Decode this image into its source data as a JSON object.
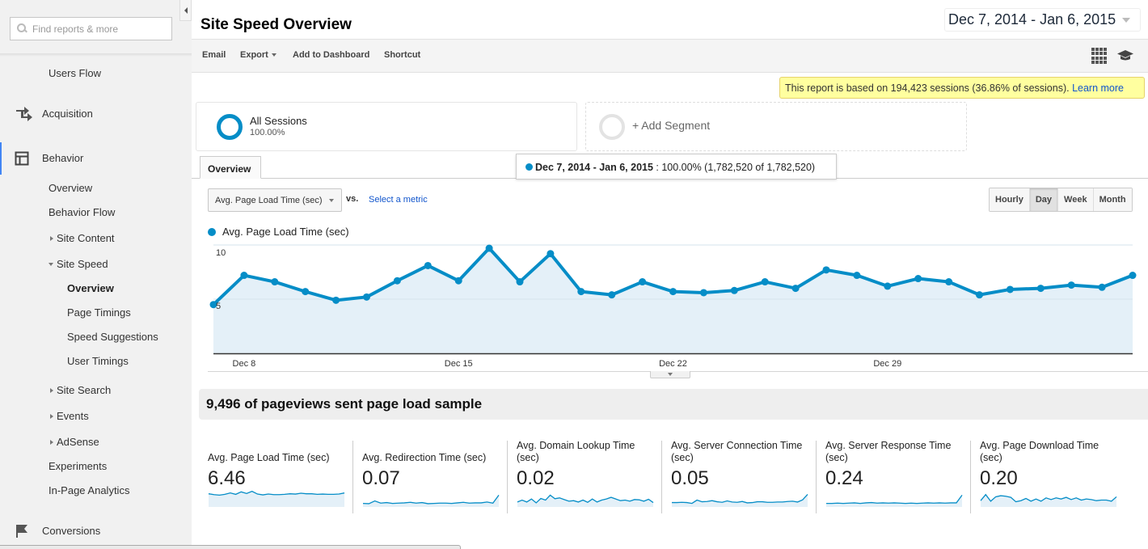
{
  "sidebar": {
    "search_placeholder": "Find reports & more",
    "items": {
      "users_flow": "Users Flow",
      "acquisition": "Acquisition",
      "behavior": "Behavior",
      "overview": "Overview",
      "behavior_flow": "Behavior Flow",
      "site_content": "Site Content",
      "site_speed": "Site Speed",
      "ss_overview": "Overview",
      "page_timings": "Page Timings",
      "speed_suggestions": "Speed Suggestions",
      "user_timings": "User Timings",
      "site_search": "Site Search",
      "events": "Events",
      "adsense": "AdSense",
      "experiments": "Experiments",
      "in_page_analytics": "In-Page Analytics",
      "conversions": "Conversions"
    }
  },
  "header": {
    "title": "Site Speed Overview",
    "date_range": "Dec 7, 2014 - Jan 6, 2015"
  },
  "toolbar": {
    "email": "Email",
    "export": "Export",
    "add_to_dashboard": "Add to Dashboard",
    "shortcut": "Shortcut"
  },
  "sampling": {
    "text": "This report is based on 194,423 sessions (36.86% of sessions).",
    "link": "Learn more"
  },
  "segments": {
    "all_name": "All Sessions",
    "all_pct": "100.00%",
    "add_label": "+ Add Segment"
  },
  "tabs": {
    "overview": "Overview"
  },
  "tooltip": {
    "range": "Dec 7, 2014 - Jan 6, 2015",
    "detail": " : 100.00% (1,782,520 of 1,782,520)"
  },
  "metric_selector": {
    "selected": "Avg. Page Load Time (sec)",
    "vs": "vs.",
    "select_metric": "Select a metric"
  },
  "periods": {
    "hourly": "Hourly",
    "day": "Day",
    "week": "Week",
    "month": "Month",
    "active": "Day"
  },
  "colors": {
    "accent": "#058dc7",
    "area_fill": "#e4f0f8",
    "link": "#1155cc",
    "note_bg": "#ffff9f"
  },
  "chart_data": {
    "type": "area",
    "title": "",
    "legend": [
      "Avg. Page Load Time (sec)"
    ],
    "legend_position": "top-left",
    "ylabel": "",
    "xlabel": "",
    "ylim": [
      0,
      10
    ],
    "yticks": [
      "10",
      "5"
    ],
    "ytick_values": [
      10,
      5
    ],
    "xtick_labels": [
      "Dec 8",
      "Dec 15",
      "Dec 22",
      "Dec 29"
    ],
    "xtick_indices": [
      1,
      8,
      15,
      22
    ],
    "x": [
      "Dec 7",
      "Dec 8",
      "Dec 9",
      "Dec 10",
      "Dec 11",
      "Dec 12",
      "Dec 13",
      "Dec 14",
      "Dec 15",
      "Dec 16",
      "Dec 17",
      "Dec 18",
      "Dec 19",
      "Dec 20",
      "Dec 21",
      "Dec 22",
      "Dec 23",
      "Dec 24",
      "Dec 25",
      "Dec 26",
      "Dec 27",
      "Dec 28",
      "Dec 29",
      "Dec 30",
      "Dec 31",
      "Jan 1",
      "Jan 2",
      "Jan 3",
      "Jan 4",
      "Jan 5",
      "Jan 6"
    ],
    "series": [
      {
        "name": "Avg. Page Load Time (sec)",
        "values": [
          4.5,
          7.2,
          6.6,
          5.7,
          4.9,
          5.2,
          6.7,
          8.1,
          6.7,
          9.7,
          6.6,
          9.2,
          5.7,
          5.4,
          6.6,
          5.7,
          5.6,
          5.8,
          6.6,
          6.0,
          7.7,
          7.2,
          6.2,
          6.9,
          6.6,
          5.4,
          5.9,
          6.0,
          6.3,
          6.1,
          7.2
        ]
      }
    ],
    "grid": true
  },
  "sample_summary": "9,496 of pageviews sent page load sample",
  "scorecards": [
    {
      "label": "Avg. Page Load Time (sec)",
      "value": "6.46",
      "spark": [
        4.5,
        4.2,
        4.0,
        4.3,
        4.8,
        4.3,
        5.2,
        4.6,
        5.4,
        4.4,
        4.1,
        4.4,
        4.2,
        4.2,
        4.3,
        4.5,
        4.4,
        4.7,
        4.5,
        4.5,
        4.3,
        4.4,
        4.3,
        4.3,
        4.4,
        4.8
      ]
    },
    {
      "label": "Avg. Redirection Time (sec)",
      "value": "0.07",
      "spark": [
        1.0,
        0.9,
        1.9,
        1.1,
        1.3,
        1.0,
        1.1,
        1.2,
        1.4,
        1.1,
        1.3,
        0.9,
        1.0,
        1.1,
        1.1,
        1.0,
        1.2,
        1.4,
        1.1,
        1.2,
        1.2,
        1.5,
        1.1,
        4.0
      ]
    },
    {
      "label": "Avg. Domain Lookup Time (sec)",
      "value": "0.02",
      "spark": [
        1.5,
        2.2,
        1.5,
        2.6,
        1.2,
        2.8,
        2.2,
        4.0,
        2.7,
        3.0,
        2.4,
        1.8,
        2.0,
        1.5,
        2.2,
        1.4,
        2.6,
        1.5,
        2.2,
        2.6,
        3.2,
        2.6,
        2.0,
        2.2,
        1.8,
        2.4,
        2.3,
        1.8,
        2.5,
        1.3
      ]
    },
    {
      "label": "Avg. Server Connection Time (sec)",
      "value": "0.05",
      "spark": [
        1.3,
        1.3,
        1.4,
        1.3,
        1.0,
        2.2,
        1.6,
        1.7,
        2.0,
        1.6,
        1.4,
        1.9,
        1.5,
        1.4,
        1.7,
        1.2,
        1.3,
        1.6,
        1.6,
        1.4,
        1.4,
        1.5,
        1.5,
        1.7,
        1.8,
        1.5,
        2.3,
        4.3
      ]
    },
    {
      "label": "Avg. Server Response Time (sec)",
      "value": "0.24",
      "spark": [
        1.0,
        1.0,
        1.1,
        1.0,
        1.1,
        1.2,
        1.0,
        1.2,
        1.3,
        1.1,
        1.2,
        1.1,
        1.2,
        1.1,
        1.0,
        1.1,
        1.0,
        1.1,
        1.2,
        1.1,
        1.2,
        1.1,
        1.2,
        1.2,
        4.0
      ]
    },
    {
      "label": "Avg. Page Download Time (sec)",
      "value": "0.20",
      "spark": [
        2.0,
        4.2,
        1.8,
        3.4,
        3.8,
        3.6,
        3.2,
        1.6,
        2.0,
        2.8,
        1.8,
        2.6,
        1.8,
        3.0,
        2.4,
        3.0,
        2.6,
        3.2,
        2.4,
        3.0,
        2.2,
        2.6,
        2.4,
        2.0,
        2.2,
        2.2,
        1.8,
        3.4
      ]
    }
  ]
}
